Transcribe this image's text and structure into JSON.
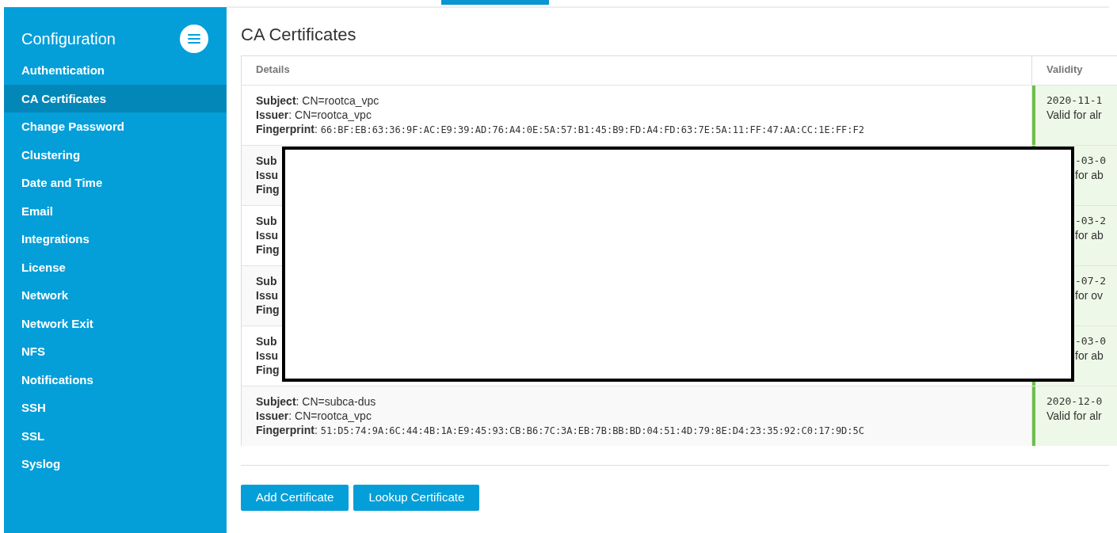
{
  "sidebar": {
    "title": "Configuration",
    "items": [
      {
        "label": "Authentication",
        "selected": false
      },
      {
        "label": "CA Certificates",
        "selected": true
      },
      {
        "label": "Change Password",
        "selected": false
      },
      {
        "label": "Clustering",
        "selected": false
      },
      {
        "label": "Date and Time",
        "selected": false
      },
      {
        "label": "Email",
        "selected": false
      },
      {
        "label": "Integrations",
        "selected": false
      },
      {
        "label": "License",
        "selected": false
      },
      {
        "label": "Network",
        "selected": false
      },
      {
        "label": "Network Exit",
        "selected": false
      },
      {
        "label": "NFS",
        "selected": false
      },
      {
        "label": "Notifications",
        "selected": false
      },
      {
        "label": "SSH",
        "selected": false
      },
      {
        "label": "SSL",
        "selected": false
      },
      {
        "label": "Syslog",
        "selected": false
      }
    ]
  },
  "page_title": "CA Certificates",
  "table": {
    "columns": [
      "Details",
      "Validity"
    ],
    "rows": [
      {
        "kind": "full",
        "lines": [
          "**Subject**: CN=rootca_vpc",
          "**Issuer**: CN=rootca_vpc",
          "**Fingerprint**: 66:BF:EB:63:36:9F:AC:E9:39:AD:76:A4:0E:5A:57:B1:45:B9:FD:A4:FD:63:7E:5A:11:FF:47:AA:CC:1E:FF:F2"
        ],
        "date": "2020-11-1",
        "note": "Valid for alr"
      },
      {
        "kind": "partial",
        "lines": [
          "Sub",
          "Issu",
          "Fing"
        ],
        "date": "-03-0",
        "note": "for ab"
      },
      {
        "kind": "partial",
        "lines": [
          "Sub",
          "Issu",
          "Fing"
        ],
        "date": "-03-2",
        "note": "for ab"
      },
      {
        "kind": "partial",
        "lines": [
          "Sub",
          "Issu",
          "Fing"
        ],
        "date": "-07-2",
        "note": "for ov"
      },
      {
        "kind": "partial",
        "lines": [
          "Sub",
          "Issu",
          "Fing"
        ],
        "date": "-03-0",
        "note": "for ab"
      },
      {
        "kind": "full",
        "lines": [
          "**Subject**: CN=subca-dus",
          "**Issuer**: CN=rootca_vpc",
          "**Fingerprint**: 51:D5:74:9A:6C:44:4B:1A:E9:45:93:CB:B6:7C:3A:EB:7B:BB:BD:04:51:4D:79:8E:D4:23:35:92:C0:17:9D:5C"
        ],
        "date": "2020-12-0",
        "note": "Valid for alr"
      }
    ]
  },
  "buttons": [
    "Add Certificate",
    "Lookup Certificate"
  ]
}
